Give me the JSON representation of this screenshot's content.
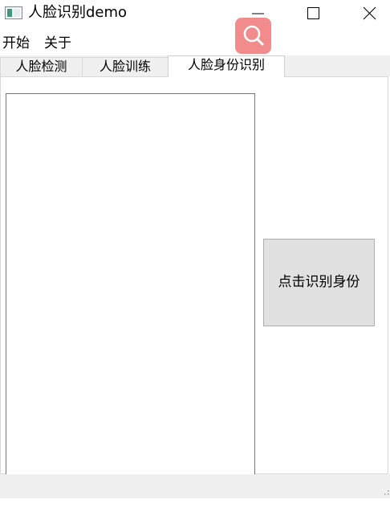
{
  "window": {
    "title": "人脸识别demo"
  },
  "menu": {
    "items": [
      "开始",
      "关于"
    ]
  },
  "tabs": [
    {
      "label": "人脸检测",
      "active": false
    },
    {
      "label": "人脸训练",
      "active": false
    },
    {
      "label": "人脸身份识别",
      "active": true
    }
  ],
  "content": {
    "identify_button_label": "点击识别身份"
  },
  "icons": {
    "search_badge": "search-icon",
    "search_badge_color": "#f28b8b"
  }
}
